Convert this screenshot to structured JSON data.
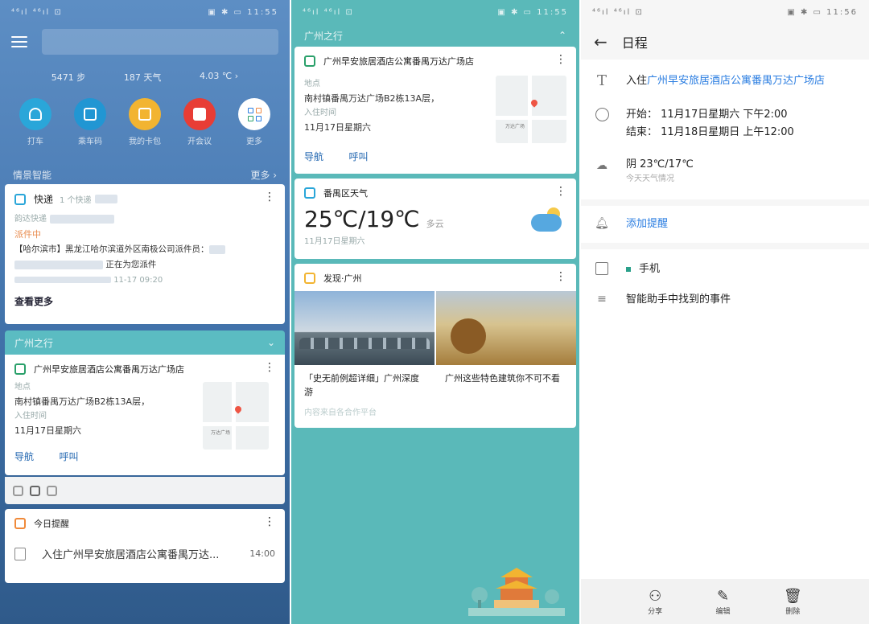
{
  "panel1": {
    "status_left": "⁴⁶ıl ⁴⁶ıl ⊡",
    "status_right": "▣ ✱ ▭ 11:55",
    "stats": [
      "5471 步",
      "187 天气",
      "4.03 ℃"
    ],
    "apps": [
      {
        "label": "打车",
        "color": "#2aa6d9"
      },
      {
        "label": "乘车码",
        "color": "#2196d3"
      },
      {
        "label": "我的卡包",
        "color": "#f2b431"
      },
      {
        "label": "开会议",
        "color": "#e83d35"
      },
      {
        "label": "更多",
        "color": "#ffffff"
      }
    ],
    "section_title": "情景智能",
    "section_more": "更多",
    "express": {
      "title": "快递",
      "meta": "1 个快递",
      "company": "韵达快递",
      "status": "派件中",
      "detail_1": "【哈尔滨市】黑龙江哈尔滨道外区南极公司派件员：",
      "detail_2": "正在为您派件",
      "time": "11-17 09:20",
      "more": "查看更多"
    },
    "trip_header": "广州之行",
    "hotel": {
      "name": "广州早安旅居酒店公寓番禺万达广场店",
      "addr_label": "地点",
      "addr": "南村镇番禺万达广场B2栋13A层，",
      "checkin_label": "入住时间",
      "checkin": "11月17日星期六",
      "nav": "导航",
      "call": "呼叫",
      "map_text": "万达广场"
    },
    "reminder": {
      "title": "今日提醒",
      "item": "入住广州早安旅居酒店公寓番禺万达...",
      "time": "14:00"
    }
  },
  "panel2": {
    "status_left": "⁴⁶ıl ⁴⁶ıl ⊡",
    "status_right": "▣ ✱ ▭ 11:55",
    "trip_header": "广州之行",
    "hotel": {
      "name": "广州早安旅居酒店公寓番禺万达广场店",
      "addr_label": "地点",
      "addr": "南村镇番禺万达广场B2栋13A层，",
      "checkin_label": "入住时间",
      "checkin": "11月17日星期六",
      "nav": "导航",
      "call": "呼叫",
      "map_text": "万达广场"
    },
    "weather": {
      "title": "番禺区天气",
      "temp": "25℃/19℃",
      "cond": "多云",
      "date": "11月17日星期六"
    },
    "discover": {
      "title": "发现·广州",
      "cap1": "「史无前例超详细」广州深度游",
      "cap2": "广州这些特色建筑你不可不看",
      "footer": "内容来自各合作平台"
    }
  },
  "panel3": {
    "status_left": "⁴⁶ıl ⁴⁶ıl ⊡",
    "status_right": "▣ ✱ ▭ 11:56",
    "title": "日程",
    "event_prefix": "入住",
    "event_link": "广州早安旅居酒店公寓番禺万达广场店",
    "start": "开始：  11月17日星期六 下午2:00",
    "end": "结束：  11月18日星期日 上午12:00",
    "weather": "阴 23℃/17℃",
    "weather_sub": "今天天气情况",
    "add_reminder": "添加提醒",
    "calendar": "手机",
    "source": "智能助手中找到的事件",
    "actions": [
      "分享",
      "编辑",
      "删除"
    ]
  }
}
